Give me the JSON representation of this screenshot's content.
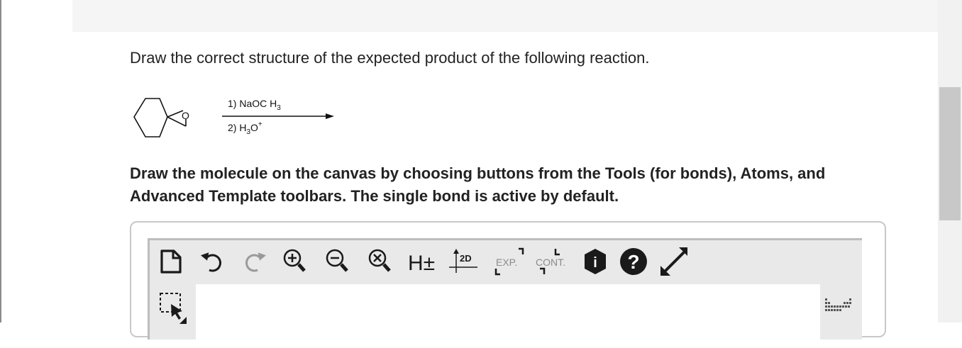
{
  "question": {
    "prompt": "Draw the correct structure of the expected product of the following reaction."
  },
  "reaction": {
    "reactant_label": "O",
    "reagent_step1": "1) NaOC H",
    "reagent_step1_sub": "3",
    "reagent_step2": "2) H",
    "reagent_step2_sub": "3",
    "reagent_step2_tail": "O",
    "reagent_step2_sup": "+"
  },
  "instructions": {
    "line1": "Draw the molecule on the canvas by choosing buttons from the Tools (for bonds), Atoms, and",
    "line2": "Advanced Template toolbars. The single bond is active by default."
  },
  "toolbar": {
    "exp_label": "EXP.",
    "cont_label": "CONT.",
    "explicit_h_label": "H±",
    "clean2d_label": "2D",
    "info_label": "i",
    "help_label": "?"
  },
  "colors": {
    "icon_dark": "#1a1a1a",
    "icon_disabled": "#9a9a9a",
    "frame_bg": "#e9e9e9",
    "scroll_thumb": "#c8c8c8"
  }
}
